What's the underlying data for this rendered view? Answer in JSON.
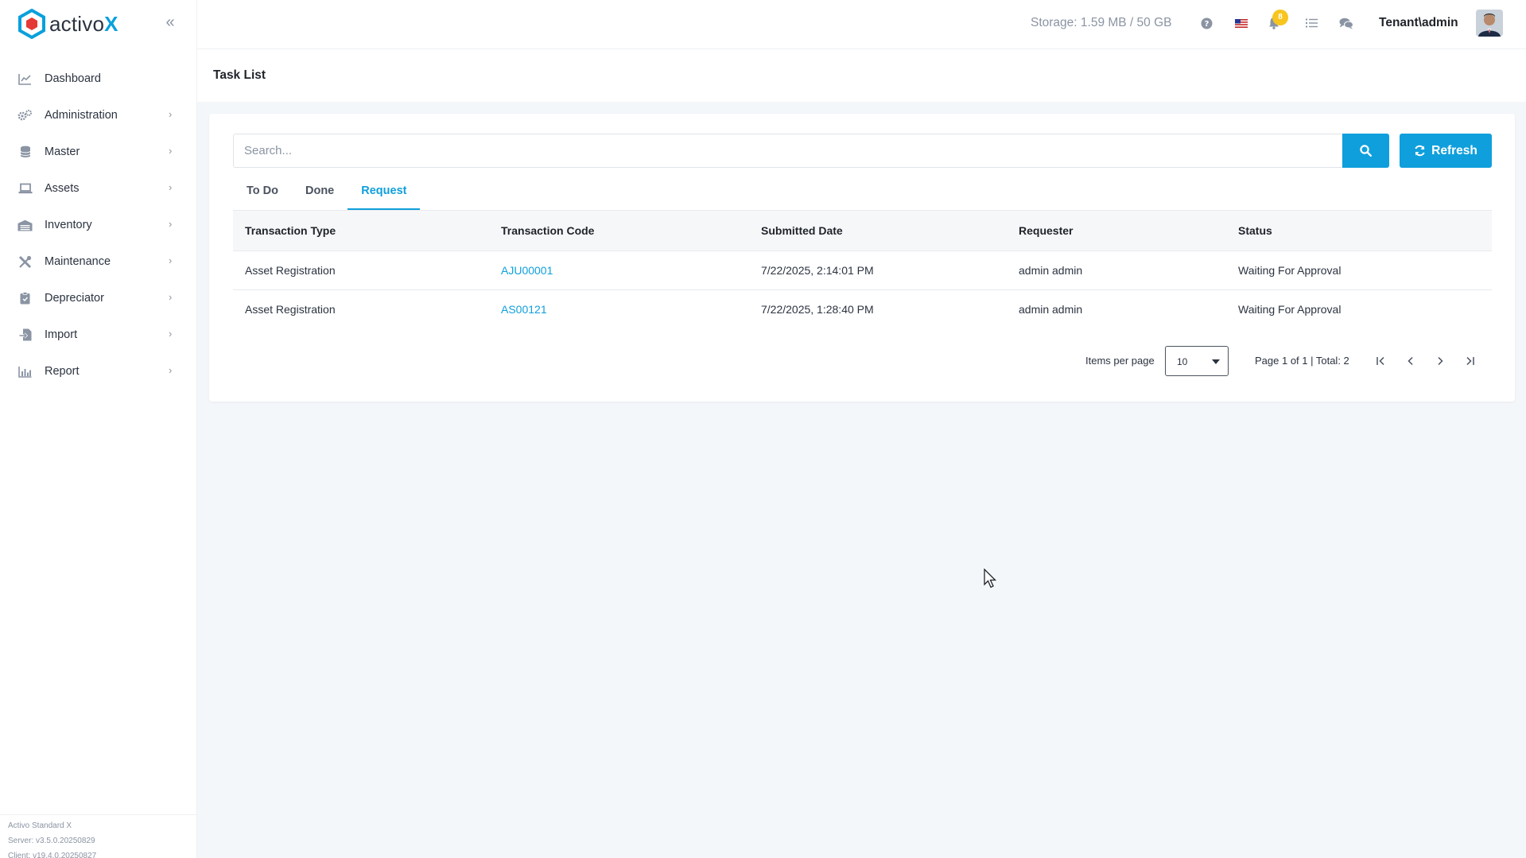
{
  "brand": {
    "name_prefix": "activo",
    "name_suffix": "X"
  },
  "colors": {
    "accent": "#0f9fdc",
    "badge": "#f7c51e",
    "muted": "#8a94a3"
  },
  "sidebar": {
    "items": [
      {
        "label": "Dashboard",
        "icon": "chart-line-icon",
        "has_children": false
      },
      {
        "label": "Administration",
        "icon": "gears-icon",
        "has_children": true
      },
      {
        "label": "Master",
        "icon": "database-icon",
        "has_children": true
      },
      {
        "label": "Assets",
        "icon": "laptop-icon",
        "has_children": true
      },
      {
        "label": "Inventory",
        "icon": "warehouse-icon",
        "has_children": true
      },
      {
        "label": "Maintenance",
        "icon": "tools-icon",
        "has_children": true
      },
      {
        "label": "Depreciator",
        "icon": "clipboard-icon",
        "has_children": true
      },
      {
        "label": "Import",
        "icon": "file-import-icon",
        "has_children": true
      },
      {
        "label": "Report",
        "icon": "bar-chart-icon",
        "has_children": true
      }
    ],
    "footer": {
      "product": "Activo Standard X",
      "server": "Server: v3.5.0.20250829",
      "client": "Client: v19.4.0.20250827"
    }
  },
  "topbar": {
    "storage": "Storage: 1.59 MB / 50 GB",
    "notification_count": "8",
    "user": "Tenant\\admin"
  },
  "page": {
    "title": "Task List"
  },
  "search": {
    "placeholder": "Search..."
  },
  "toolbar": {
    "refresh_label": "Refresh"
  },
  "tabs": [
    {
      "label": "To Do",
      "active": false
    },
    {
      "label": "Done",
      "active": false
    },
    {
      "label": "Request",
      "active": true
    }
  ],
  "table": {
    "headers": [
      "Transaction Type",
      "Transaction Code",
      "Submitted Date",
      "Requester",
      "Status"
    ],
    "rows": [
      [
        "Asset Registration",
        "AJU00001",
        "7/22/2025, 2:14:01 PM",
        "admin admin",
        "Waiting For Approval"
      ],
      [
        "Asset Registration",
        "AS00121",
        "7/22/2025, 1:28:40 PM",
        "admin admin",
        "Waiting For Approval"
      ]
    ]
  },
  "pager": {
    "items_per_page_label": "Items per page",
    "items_per_page": "10",
    "page_info": "Page 1 of 1 | Total: 2"
  }
}
